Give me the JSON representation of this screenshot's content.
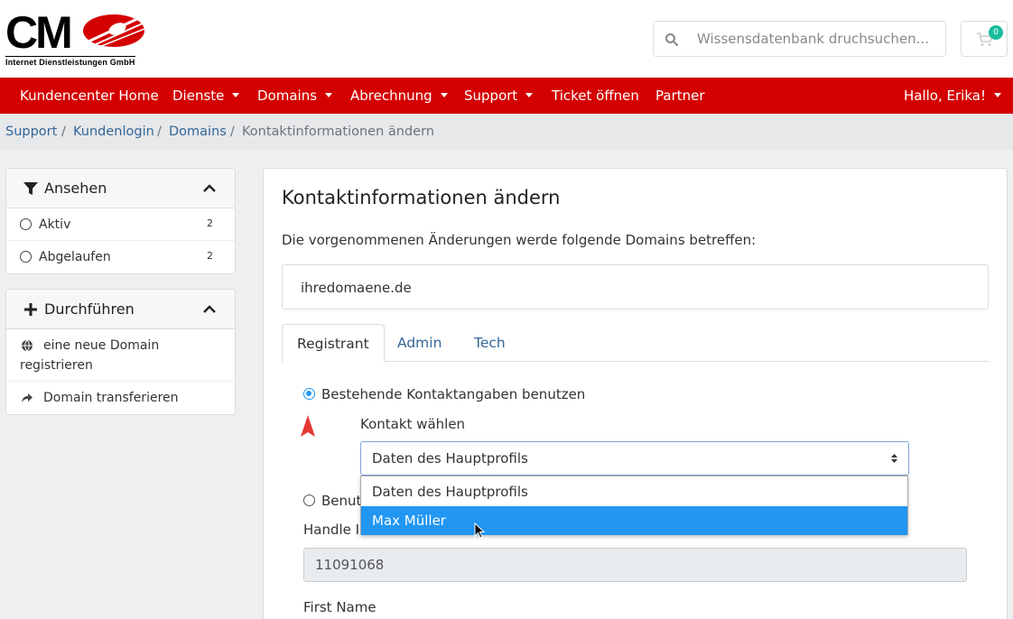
{
  "brand": {
    "logo_text": "CM",
    "logo_subtitle": "Internet Dienstleistungen GmbH",
    "accent_color": "#d40000"
  },
  "search": {
    "placeholder": "Wissensdatenbank druchsuchen..."
  },
  "cart": {
    "count": "0"
  },
  "nav": {
    "items": [
      {
        "label": "Kundencenter Home",
        "dropdown": false
      },
      {
        "label": "Dienste",
        "dropdown": true
      },
      {
        "label": "Domains",
        "dropdown": true
      },
      {
        "label": "Abrechnung",
        "dropdown": true
      },
      {
        "label": "Support",
        "dropdown": true
      },
      {
        "label": "Ticket öffnen",
        "dropdown": false
      },
      {
        "label": "Partner",
        "dropdown": false
      }
    ],
    "user": "Hallo, Erika!"
  },
  "breadcrumb": {
    "items": [
      "Support",
      "Kundenlogin",
      "Domains"
    ],
    "sep": "/",
    "active": "Kontaktinformationen ändern"
  },
  "sidebar": {
    "view": {
      "title": "Ansehen",
      "items": [
        {
          "label": "Aktiv",
          "count": "2"
        },
        {
          "label": "Abgelaufen",
          "count": "2"
        }
      ]
    },
    "actions": {
      "title": "Durchführen",
      "items": [
        {
          "label": "eine neue Domain registrieren",
          "icon": "globe-icon"
        },
        {
          "label": "Domain transferieren",
          "icon": "share-arrow-icon"
        }
      ]
    }
  },
  "main": {
    "title": "Kontaktinformationen ändern",
    "description": "Die vorgenommenen Änderungen werde folgende Domains betreffen:",
    "domain": "ihredomaene.de",
    "tabs": [
      "Registrant",
      "Admin",
      "Tech"
    ],
    "active_tab": "Registrant",
    "option_existing": "Bestehende Kontaktangaben benutzen",
    "contact_label": "Kontakt wählen",
    "select_value": "Daten des Hauptprofils",
    "dropdown_options": [
      "Daten des Hauptprofils",
      "Max Müller"
    ],
    "highlighted_option": "Max Müller",
    "option_custom_partial": "Benut",
    "handle_label_partial": "Handle I",
    "handle_value": "11091068",
    "first_name_label": "First Name"
  }
}
